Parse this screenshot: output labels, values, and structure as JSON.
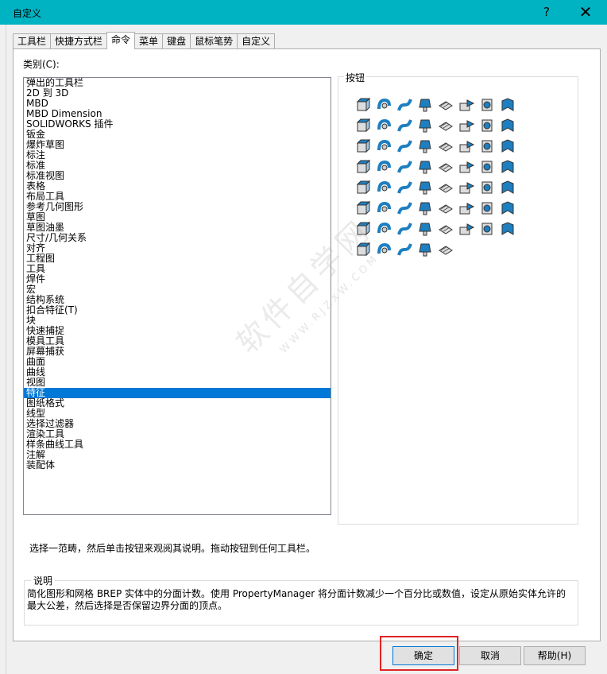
{
  "window": {
    "title": "自定义",
    "help_glyph": "?",
    "close_glyph": "✕"
  },
  "tabs": [
    "工具栏",
    "快捷方式栏",
    "命令",
    "菜单",
    "键盘",
    "鼠标笔势",
    "自定义"
  ],
  "active_tab": "命令",
  "categories": {
    "label": "类别(C):",
    "items": [
      "弹出的工具栏",
      "2D 到 3D",
      "MBD",
      "MBD Dimension",
      "SOLIDWORKS 插件",
      "钣金",
      "爆炸草图",
      "标注",
      "标准",
      "标准视图",
      "表格",
      "布局工具",
      "参考几何图形",
      "草图",
      "草图油墨",
      "尺寸/几何关系",
      "对齐",
      "工程图",
      "工具",
      "焊件",
      "宏",
      "结构系统",
      "扣合特征(T)",
      "块",
      "快速捕捉",
      "模具工具",
      "屏幕捕获",
      "曲面",
      "曲线",
      "视图",
      "特征",
      "图纸格式",
      "线型",
      "选择过滤器",
      "渲染工具",
      "样条曲线工具",
      "注解",
      "装配体"
    ],
    "selected": "特征"
  },
  "buttons_group": {
    "label": "按钮",
    "icons": [
      "extruded-boss-icon",
      "revolved-boss-icon",
      "swept-boss-icon",
      "lofted-boss-icon",
      "boundary-boss-icon",
      "extruded-cut-icon",
      "hole-wizard-icon",
      "revolved-cut-icon",
      "swept-cut-icon",
      "lofted-cut-icon",
      "boundary-cut-icon",
      "fillet-icon",
      "linear-pattern-icon",
      "rib-icon",
      "draft-icon",
      "shell-icon",
      "wrap-icon",
      "dome-icon",
      "mirror-icon",
      "reference-geometry-icon",
      "curves-icon",
      "instant3d-icon",
      "chamfer-icon",
      "variable-fillet-icon",
      "circular-pattern-icon",
      "intersect-icon",
      "scale-icon",
      "thicken-icon",
      "combine-icon",
      "split-icon",
      "move-copy-icon",
      "delete-face-icon",
      "freeform-icon",
      "indent-icon",
      "flex-icon",
      "deform-icon",
      "cavity-icon",
      "sketch-pattern-icon",
      "fill-pattern-icon",
      "curve-pattern-icon",
      "table-pattern-icon",
      "mirror-body-icon",
      "imported-icon",
      "base-flange-icon",
      "wrap-text-icon",
      "sweep-path-icon",
      "saved-body-icon",
      "split-line-icon",
      "mold-icon",
      "cosmetic-thread-icon",
      "tolerance-icon",
      "edit-body-icon",
      "bodies-icon",
      "break-icon",
      "defeature-icon",
      "check-icon",
      "mesh-3d-icon",
      "simplify-icon",
      "pipe-icon",
      "solid-body-icon",
      "surface-cut-icon"
    ]
  },
  "instructions": "选择一范畴，然后单击按钮来观阅其说明。拖动按钮到任何工具栏。",
  "description": {
    "label": "说明",
    "text": "简化图形和网格 BREP 实体中的分面计数。使用 PropertyManager 将分面计数减少一个百分比或数值，设定从原始实体允许的最大公差，然后选择是否保留边界分面的顶点。"
  },
  "footer": {
    "ok_label": "确定",
    "cancel_label": "取消",
    "help_label": "帮助(H)"
  },
  "watermark": {
    "main": "软件自学网",
    "sub": "WWW.RJZXW.COM"
  },
  "colors": {
    "titlebar": "#00b3c3",
    "selection": "#0078d7",
    "icon_blue": "#1e7fc0",
    "highlight": "#e02424"
  }
}
